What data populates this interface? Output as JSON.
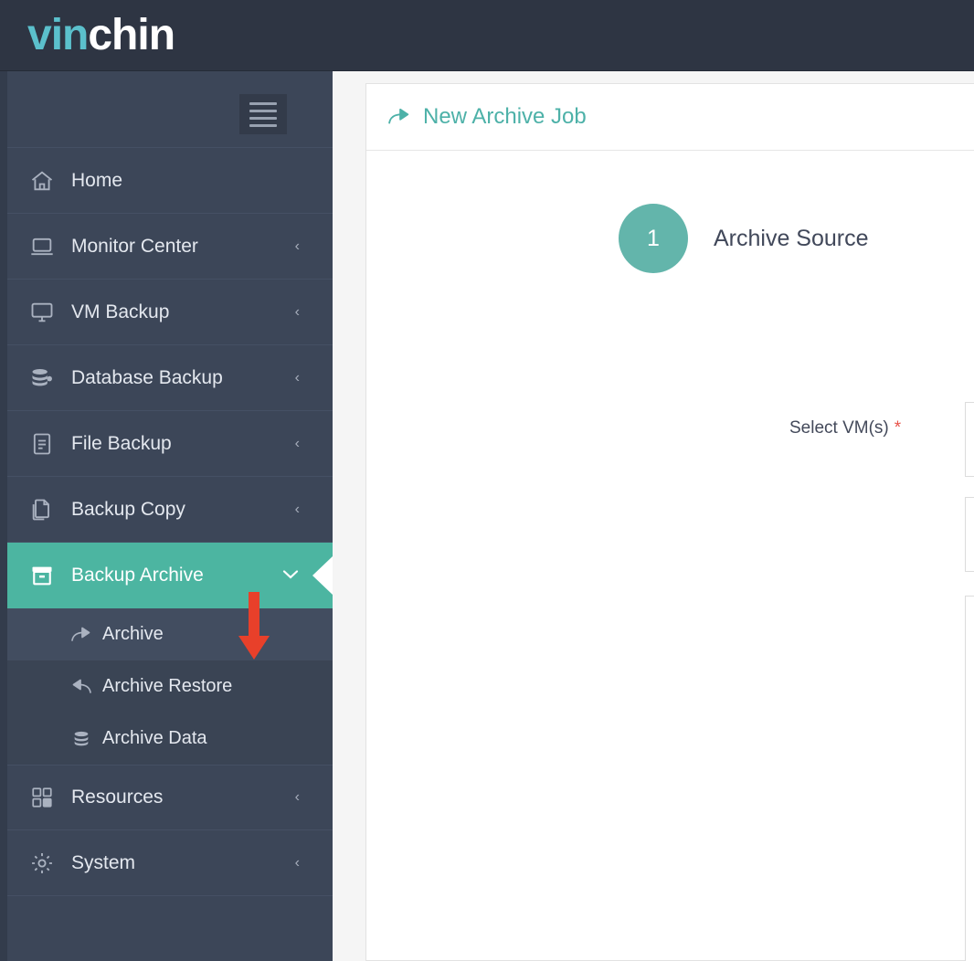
{
  "brand": {
    "logo_prefix": "vin",
    "logo_suffix": "chin"
  },
  "sidebar": {
    "toggle_name": "hamburger-menu",
    "items": [
      {
        "label": "Home",
        "icon": "home-icon",
        "has_chevron": false,
        "active": false
      },
      {
        "label": "Monitor Center",
        "icon": "monitor-icon",
        "has_chevron": true,
        "active": false
      },
      {
        "label": "VM Backup",
        "icon": "desktop-icon",
        "has_chevron": true,
        "active": false
      },
      {
        "label": "Database Backup",
        "icon": "database-icon",
        "has_chevron": true,
        "active": false
      },
      {
        "label": "File Backup",
        "icon": "file-icon",
        "has_chevron": true,
        "active": false
      },
      {
        "label": "Backup Copy",
        "icon": "copy-icon",
        "has_chevron": true,
        "active": false
      },
      {
        "label": "Backup Archive",
        "icon": "archive-box-icon",
        "has_chevron": true,
        "active": true
      },
      {
        "label": "Resources",
        "icon": "grid-icon",
        "has_chevron": true,
        "active": false
      },
      {
        "label": "System",
        "icon": "gear-icon",
        "has_chevron": true,
        "active": false
      }
    ],
    "submenu": [
      {
        "label": "Archive",
        "icon": "share-arrow-icon",
        "selected": true
      },
      {
        "label": "Archive Restore",
        "icon": "reply-arrow-icon",
        "selected": false
      },
      {
        "label": "Archive Data",
        "icon": "database-stack-icon",
        "selected": false
      }
    ],
    "chevron_collapsed": "‹",
    "chevron_expanded": "⌄"
  },
  "main": {
    "card_title": "New Archive Job",
    "card_title_icon": "share-arrow-icon",
    "step": {
      "number": "1",
      "label": "Archive Source"
    },
    "select_vms_label": "Select VM(s)",
    "required_marker": "*"
  },
  "annotation": {
    "arrow": "red-down-arrow",
    "color": "#e8402a"
  },
  "colors": {
    "brand_teal": "#4cb5a1",
    "logo_teal": "#5bc0cc",
    "sidebar_bg": "#3c4658",
    "submenu_bg": "#3a4454",
    "topbar_bg": "#2e3543",
    "title_teal": "#4db1a8",
    "step_circle": "#63b5ab",
    "required_red": "#e8534a",
    "content_bg": "#f5f5f5"
  }
}
